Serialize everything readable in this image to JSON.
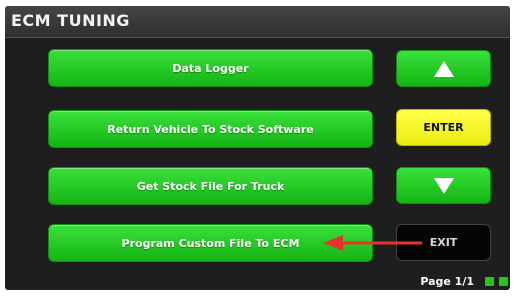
{
  "header": {
    "title": "ECM TUNING"
  },
  "menu": {
    "items": [
      {
        "label": "Data Logger"
      },
      {
        "label": "Return Vehicle To Stock Software"
      },
      {
        "label": "Get Stock File For Truck"
      },
      {
        "label": "Program Custom File To ECM"
      }
    ]
  },
  "controls": {
    "up_icon": "up-arrow-icon",
    "enter_label": "ENTER",
    "down_icon": "down-arrow-icon",
    "exit_label": "EXIT"
  },
  "footer": {
    "page_label": "Page 1/1"
  },
  "colors": {
    "button_green": "#22c822",
    "enter_yellow": "#f5f51e",
    "exit_black": "#050505",
    "annotation_red": "#e8332d",
    "screen_background": "#1e1e1e"
  }
}
